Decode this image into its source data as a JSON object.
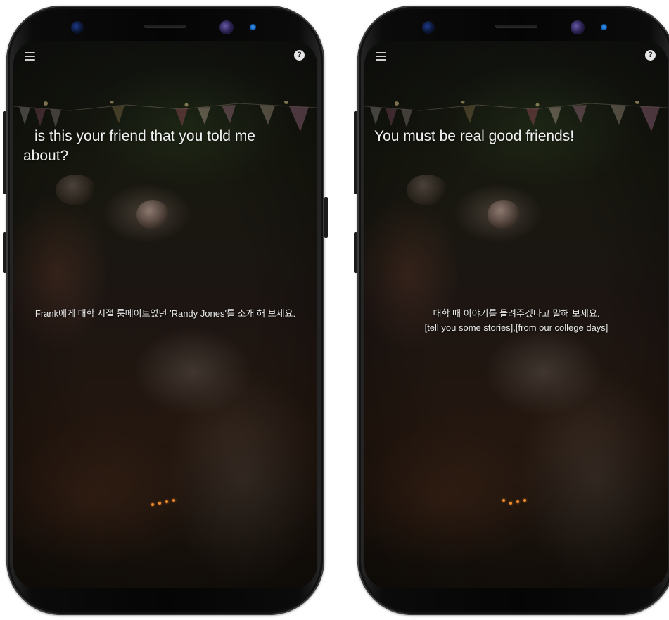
{
  "screens": [
    {
      "prompt": "is this your friend that you told me about?",
      "instruction": "Frank에게 대학 시절 룸메이트였던 'Randy Jones'를 소개 해 보세요.",
      "instruction_sub": ""
    },
    {
      "prompt": "You must be real good friends!",
      "instruction": "대학 때 이야기를 들려주겠다고 말해 보세요.",
      "instruction_sub": "[tell you some stories],[from our college days]"
    }
  ],
  "icons": {
    "menu": "hamburger-menu-icon",
    "help": "question-mark-icon",
    "help_glyph": "?"
  },
  "colors": {
    "prompt_text": "#f2f2f2",
    "instruction_text": "#e8e8e8",
    "loading_dots": "#f08a2a"
  }
}
